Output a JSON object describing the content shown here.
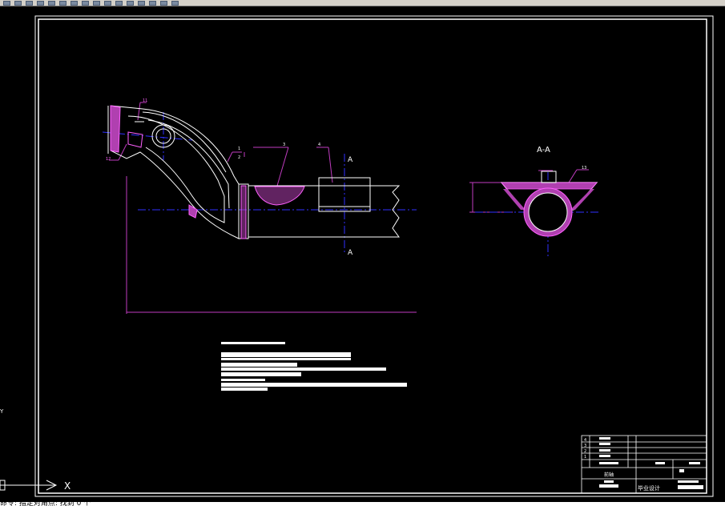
{
  "toolbar": {
    "icons": [
      "new-icon",
      "open-icon",
      "save-icon",
      "print-icon",
      "undo-icon",
      "redo-icon",
      "pan-icon",
      "zoom-icon",
      "layer-icon",
      "properties-icon",
      "match-icon",
      "block-icon",
      "insert-icon",
      "table-icon",
      "calc-icon",
      "help-icon"
    ]
  },
  "drawing": {
    "section_label_top": "A",
    "section_label_bottom": "A",
    "section_title": "A-A",
    "balloons": {
      "b1": "1",
      "b2": "2",
      "b3": "3",
      "b4": "4",
      "b11": "11",
      "b12": "12",
      "b13": "13"
    }
  },
  "title_block": {
    "row_labels": [
      "4",
      "3",
      "2",
      "1"
    ],
    "name_label": "前轴",
    "project_label": "毕业设计"
  },
  "ucs": {
    "x_label": "X",
    "y_label": "Y"
  },
  "command_line": {
    "text": "命令: 指定对角点: 找到 0 个"
  }
}
